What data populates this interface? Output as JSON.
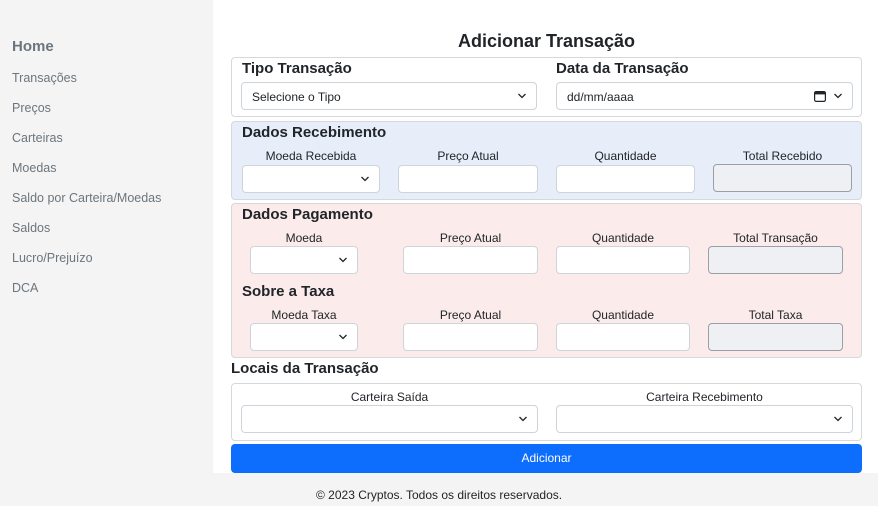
{
  "sidebar": {
    "home": "Home",
    "items": [
      "Transações",
      "Preços",
      "Carteiras",
      "Moedas",
      "Saldo por Carteira/Moedas",
      "Saldos",
      "Lucro/Prejuízo",
      "DCA"
    ]
  },
  "page_title": "Adicionar Transação",
  "tipo": {
    "label": "Tipo Transação",
    "value": "Selecione o Tipo"
  },
  "data": {
    "label": "Data da Transação",
    "value": "dd/mm/aaaa"
  },
  "recebimento": {
    "title": "Dados Recebimento",
    "moeda_label": "Moeda Recebida",
    "preco_label": "Preço Atual",
    "quantidade_label": "Quantidade",
    "total_label": "Total Recebido"
  },
  "pagamento": {
    "title": "Dados Pagamento",
    "moeda_label": "Moeda",
    "preco_label": "Preço Atual",
    "quantidade_label": "Quantidade",
    "total_label": "Total Transação"
  },
  "taxa": {
    "title": "Sobre a Taxa",
    "moeda_label": "Moeda Taxa",
    "preco_label": "Preço Atual",
    "quantidade_label": "Quantidade",
    "total_label": "Total Taxa"
  },
  "locais": {
    "title": "Locais da Transação",
    "saida_label": "Carteira Saída",
    "recebimento_label": "Carteira Recebimento"
  },
  "submit_label": "Adicionar",
  "footer": "© 2023 Cryptos. Todos os direitos reservados.",
  "colors": {
    "primary": "#0d6efd",
    "blue_section": "#e8eef9",
    "pink_section": "#fbeceb",
    "sidebar": "#f4f4f4"
  }
}
